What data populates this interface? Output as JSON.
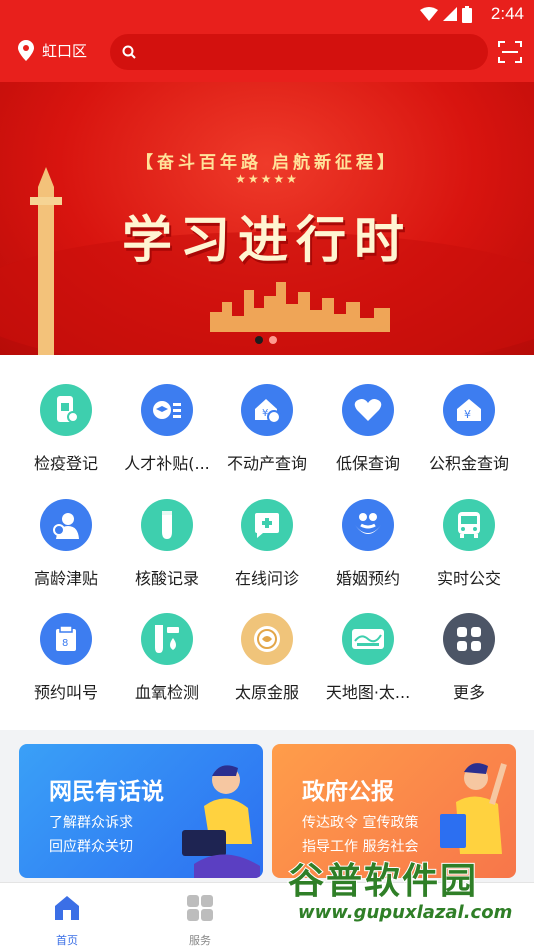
{
  "status": {
    "time": "2:44"
  },
  "header": {
    "location": "虹口区",
    "search_placeholder": ""
  },
  "banner": {
    "slogan": "【奋斗百年路 启航新征程】",
    "stars": "★★★★★",
    "title": "学习进行时",
    "page_count": 2,
    "active_page": 1
  },
  "services": [
    {
      "label": "检疫登记",
      "icon": "phone-scan-icon",
      "color": "#3ecfae"
    },
    {
      "label": "人才补贴(...",
      "icon": "graduation-cap-icon",
      "color": "#3d7df0"
    },
    {
      "label": "不动产查询",
      "icon": "house-yen-icon",
      "color": "#3d7df0"
    },
    {
      "label": "低保查询",
      "icon": "heart-icon",
      "color": "#3d7df0"
    },
    {
      "label": "公积金查询",
      "icon": "house-yen-icon",
      "color": "#3d7df0"
    },
    {
      "label": "高龄津贴",
      "icon": "elder-icon",
      "color": "#3d7df0"
    },
    {
      "label": "核酸记录",
      "icon": "test-tube-icon",
      "color": "#3ecfae"
    },
    {
      "label": "在线问诊",
      "icon": "medical-chat-icon",
      "color": "#3ecfae"
    },
    {
      "label": "婚姻预约",
      "icon": "couple-icon",
      "color": "#3d7df0"
    },
    {
      "label": "实时公交",
      "icon": "bus-icon",
      "color": "#3ecfae"
    },
    {
      "label": "预约叫号",
      "icon": "queue-ticket-icon",
      "color": "#3d7df0"
    },
    {
      "label": "血氧检测",
      "icon": "blood-oxygen-icon",
      "color": "#3ecfae"
    },
    {
      "label": "太原金服",
      "icon": "gold-coin-icon",
      "color": "#f0c47a"
    },
    {
      "label": "天地图·太...",
      "icon": "map-world-icon",
      "color": "#3ecfae"
    },
    {
      "label": "更多",
      "icon": "more-grid-icon",
      "color": "#4c5566"
    }
  ],
  "promos": [
    {
      "title": "网民有话说",
      "line1": "了解群众诉求",
      "line2": "回应群众关切",
      "color_from": "#3aa0f7",
      "color_to": "#2c6ff1"
    },
    {
      "title": "政府公报",
      "line1": "传达政令  宣传政策",
      "line2": "指导工作  服务社会",
      "color_from": "#ff9d4a",
      "color_to": "#f7764a"
    }
  ],
  "tabs": [
    {
      "label": "首页",
      "icon": "home-icon",
      "active": true
    },
    {
      "label": "服务",
      "icon": "apps-grid-icon",
      "active": false
    }
  ],
  "watermark": {
    "title": "谷普软件园",
    "url": "www.gupuxlazal.com"
  }
}
